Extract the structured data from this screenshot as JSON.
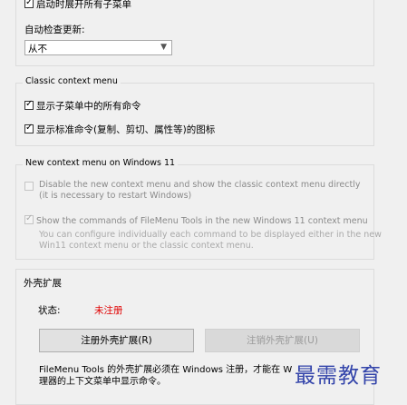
{
  "top_section": {
    "expand_all_label": "启动时展开所有子菜单",
    "expand_all_checked": true,
    "auto_update_label": "自动检查更新:",
    "auto_update_value": "从不"
  },
  "classic_menu": {
    "title": "Classic context menu",
    "show_all_label": "显示子菜单中的所有命令",
    "show_all_checked": true,
    "show_icons_label": "显示标准命令(复制、剪切、属性等)的图标",
    "show_icons_checked": true
  },
  "new_menu": {
    "title": "New context menu on Windows 11",
    "disable_line1": "Disable the new context menu and show the classic context menu directly",
    "disable_line2": "(it is necessary to restart Windows)",
    "disable_checked": false,
    "show_cmds_label": "Show the commands of FileMenu Tools in the new Windows 11 context menu",
    "show_cmds_checked": true,
    "hint_line1": "You can configure individually each command to be displayed either in the new",
    "hint_line2": "Win11 context menu or the classic context menu."
  },
  "shell_ext": {
    "title": "外壳扩展",
    "status_label": "状态:",
    "status_value": "未注册",
    "status_color": "#e00000",
    "register_button": "注册外壳扩展(R)",
    "unregister_button": "注销外壳扩展(U)",
    "note_line1": "FileMenu Tools 的外壳扩展必须在 Windows 注册，才能在 W",
    "note_line2": "理器的上下文菜单中显示命令。"
  },
  "watermark": "最需教育"
}
